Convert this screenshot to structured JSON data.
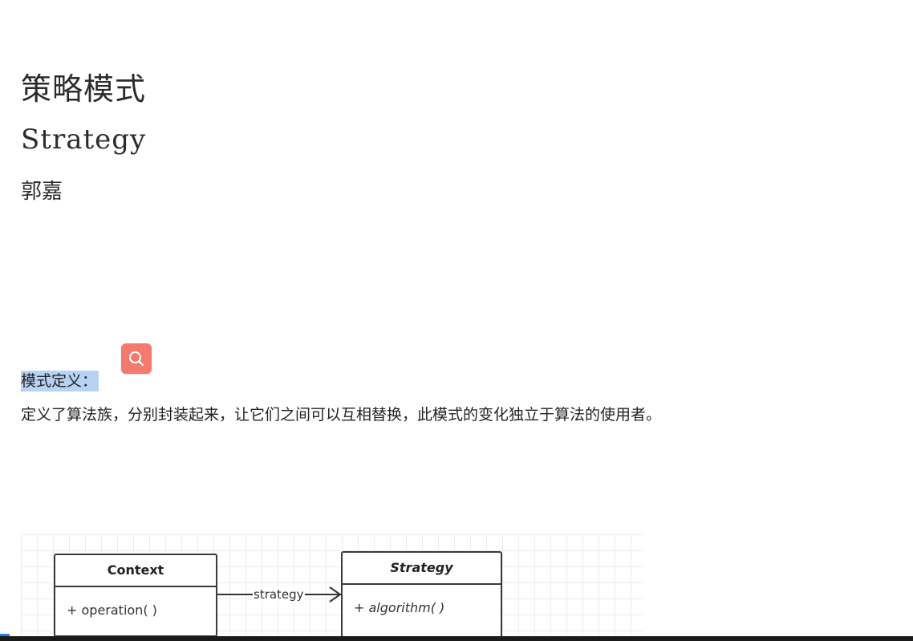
{
  "document": {
    "title_cn": "策略模式",
    "title_en": "Strategy",
    "author": "郭嘉",
    "definition_heading": "模式定义：",
    "definition_body": "定义了算法族，分别封装起来，让它们之间可以互相替换，此模式的变化独立于算法的使用者。"
  },
  "floating_tool": {
    "icon": "search-icon",
    "color": "#f47a6d"
  },
  "uml": {
    "context": {
      "name": "Context",
      "method": "+ operation( )"
    },
    "strategy": {
      "name": "Strategy",
      "method": "+ algorithm( )"
    },
    "association_label": "strategy"
  },
  "colors": {
    "selection_highlight": "#b7d2f2",
    "grid_line": "#ececec"
  }
}
